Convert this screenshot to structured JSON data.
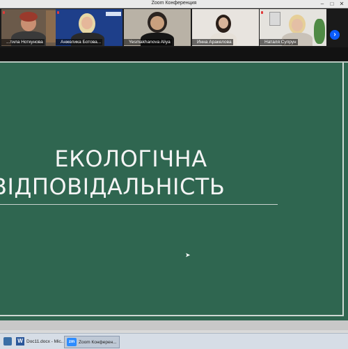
{
  "window": {
    "title": "Zoom Конференция"
  },
  "participants": [
    {
      "name": "...тила Ноткунова",
      "mic_muted": true
    },
    {
      "name": "Анжелика Ботова...",
      "mic_muted": true
    },
    {
      "name": "Yesmakhanova Aliya",
      "mic_muted": false
    },
    {
      "name": "Инна Аракелова",
      "mic_muted": false
    },
    {
      "name": "Наталя Супрун",
      "mic_muted": true
    }
  ],
  "strip_next_icon": "chevron-right-icon",
  "slide": {
    "title_line1": "ЕКОЛОГІЧНА",
    "title_line2": "ВІДПОВІДАЛЬНІСТЬ"
  },
  "taskbar": {
    "items": [
      {
        "label": "",
        "icon": "windows-icon"
      },
      {
        "label": "Doc11.docx - Mic...",
        "icon": "word-icon"
      },
      {
        "label": "Zoom Конферен...",
        "icon": "zoom-icon"
      }
    ]
  },
  "colors": {
    "slide_bg": "#2f6650",
    "accent": "#0b5cff"
  }
}
